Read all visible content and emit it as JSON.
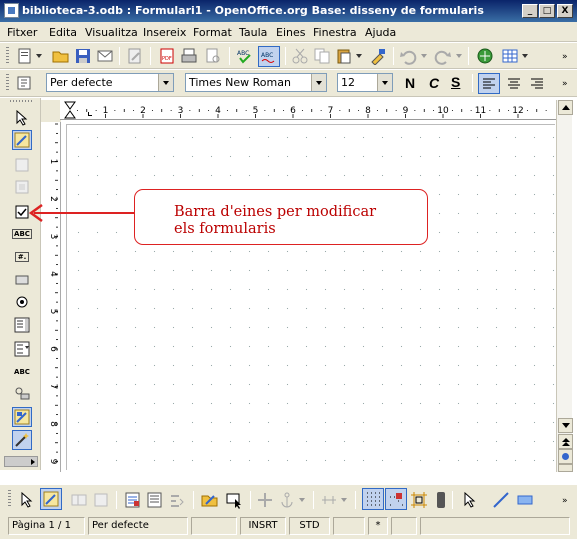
{
  "window": {
    "title": "biblioteca-3.odb : Formulari1 - OpenOffice.org Base: disseny de formularis",
    "minimize": "_",
    "maximize": "□",
    "close": "X"
  },
  "menu": [
    "Fitxer",
    "Edita",
    "Visualitza",
    "Insereix",
    "Format",
    "Taula",
    "Eines",
    "Finestra",
    "Ajuda"
  ],
  "format_toolbar": {
    "paragraph_style": "Per defecte",
    "font_name": "Times New Roman",
    "font_size": "12",
    "bold": "N",
    "italic": "C",
    "underline": "S"
  },
  "ruler": {
    "h_ticks": [
      "1",
      "2",
      "3",
      "4",
      "5",
      "6",
      "7",
      "8",
      "9",
      "10",
      "11",
      "12"
    ],
    "v_ticks": [
      "1",
      "2",
      "3",
      "4",
      "5",
      "6",
      "7",
      "8",
      "9"
    ]
  },
  "left_toolbar_labels": {
    "label_field": "ABC",
    "formatted_field": "#.",
    "group_box": "ABC"
  },
  "callout": {
    "line1": "Barra d'eines per modificar",
    "line2": "els formularis",
    "color": "#d22222"
  },
  "status": {
    "page": "Pàgina  1 / 1",
    "style": "Per defecte",
    "insert_mode": "INSRT",
    "selection_mode": "STD",
    "modified": "*"
  }
}
